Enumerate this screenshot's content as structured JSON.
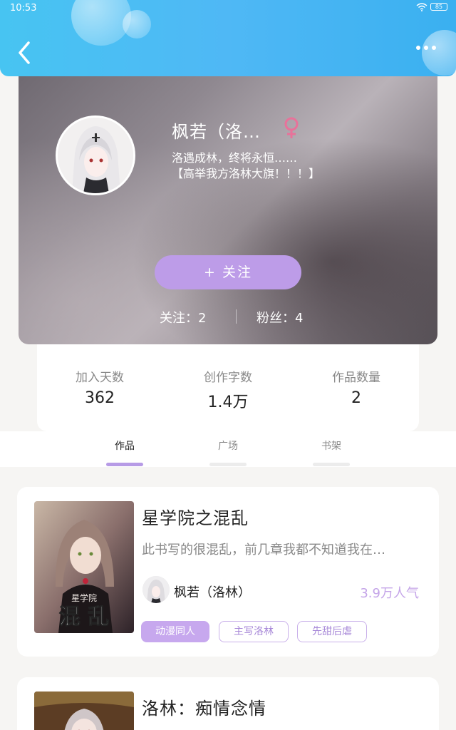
{
  "status_bar": {
    "time": "10:53",
    "battery": "85"
  },
  "profile": {
    "name": "枫若（洛…",
    "gender_symbol": "♀",
    "bio": "洛遇成林，终将永恒……\n【高举我方洛林大旗！！！】",
    "follow_label": "+   关注",
    "following_label": "关注：2",
    "followers_label": "粉丝：4"
  },
  "stats": [
    {
      "label": "加入天数",
      "value": "362"
    },
    {
      "label": "创作字数",
      "value": "1.4万"
    },
    {
      "label": "作品数量",
      "value": "2"
    }
  ],
  "tabs": [
    {
      "label": "作品",
      "active": true
    },
    {
      "label": "广场",
      "active": false
    },
    {
      "label": "书架",
      "active": false
    }
  ],
  "works": [
    {
      "title": "星学院之混乱",
      "description": "此书写的很混乱，前几章我都不知道我在…",
      "author": "枫若（洛林）",
      "popularity": "3.9万人气",
      "cover_text": "混 乱",
      "cover_subtext": "星学院",
      "tags": [
        "动漫同人",
        "主写洛林",
        "先甜后虐"
      ]
    },
    {
      "title": "洛林：痴情念情"
    }
  ],
  "colors": {
    "accent": "#bd9ce8",
    "header": "#47c4f2",
    "gender": "#e8729a"
  }
}
